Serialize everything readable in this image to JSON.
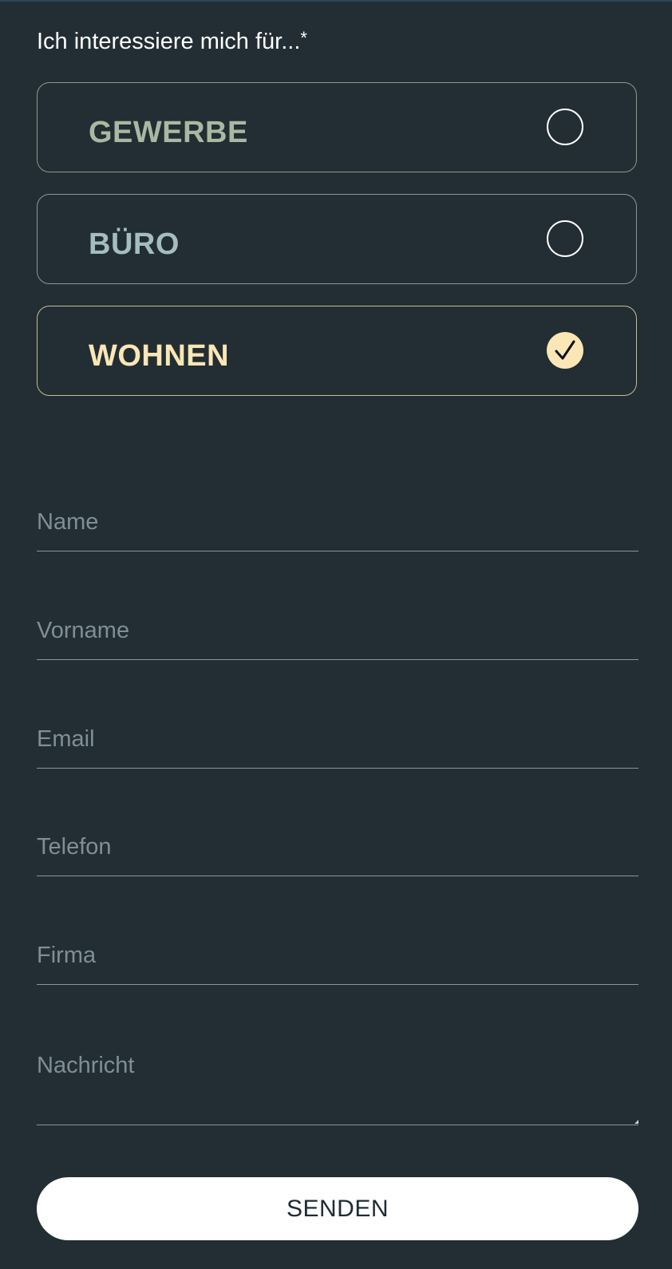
{
  "interest": {
    "label": "Ich interessiere mich für...",
    "required_mark": "*",
    "options": [
      {
        "label": "GEWERBE",
        "selected": false,
        "color": "#a9b8a2",
        "border_color": "#8b9a8c"
      },
      {
        "label": "BÜRO",
        "selected": false,
        "color": "#a5bcc0",
        "border_color": "#86979c"
      },
      {
        "label": "WOHNEN",
        "selected": true,
        "color": "#fbe6b6",
        "border_color": "#c9bc93"
      }
    ],
    "check_fill": "#fbe6b6",
    "check_icon": "check-icon"
  },
  "fields": {
    "name": {
      "placeholder": "Name",
      "value": ""
    },
    "vorname": {
      "placeholder": "Vorname",
      "value": ""
    },
    "email": {
      "placeholder": "Email",
      "value": ""
    },
    "telefon": {
      "placeholder": "Telefon",
      "value": ""
    },
    "firma": {
      "placeholder": "Firma",
      "value": ""
    },
    "nachricht": {
      "placeholder": "Nachricht",
      "value": ""
    }
  },
  "submit": {
    "label": "SENDEN"
  },
  "colors": {
    "background": "#222e33",
    "text": "#ffffff",
    "placeholder": "#7f8f94",
    "underline": "#86979c"
  }
}
